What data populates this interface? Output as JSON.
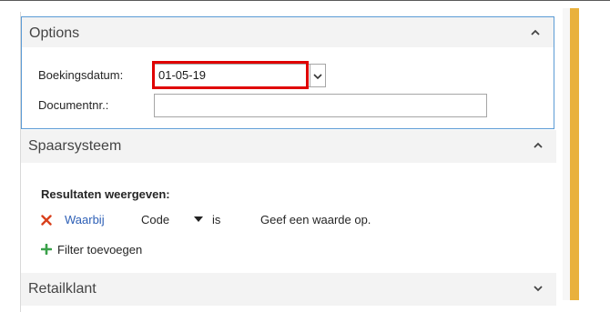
{
  "options": {
    "title": "Options",
    "booking_date_label": "Boekingsdatum:",
    "booking_date_value": "01-05-19",
    "document_label": "Documentnr.:",
    "document_value": ""
  },
  "savings": {
    "title": "Spaarsysteem",
    "results_label": "Resultaten weergeven:",
    "where_label": "Waarbij",
    "field_label": "Code",
    "operator_label": "is",
    "value_prompt": "Geef een waarde op.",
    "add_filter_label": "Filter toevoegen"
  },
  "retail": {
    "title": "Retailklant"
  },
  "colors": {
    "accent_border": "#5b9bd5",
    "focus_red": "#e00000",
    "link_blue": "#2d5fb6",
    "side_bar": "#e9b13d"
  }
}
